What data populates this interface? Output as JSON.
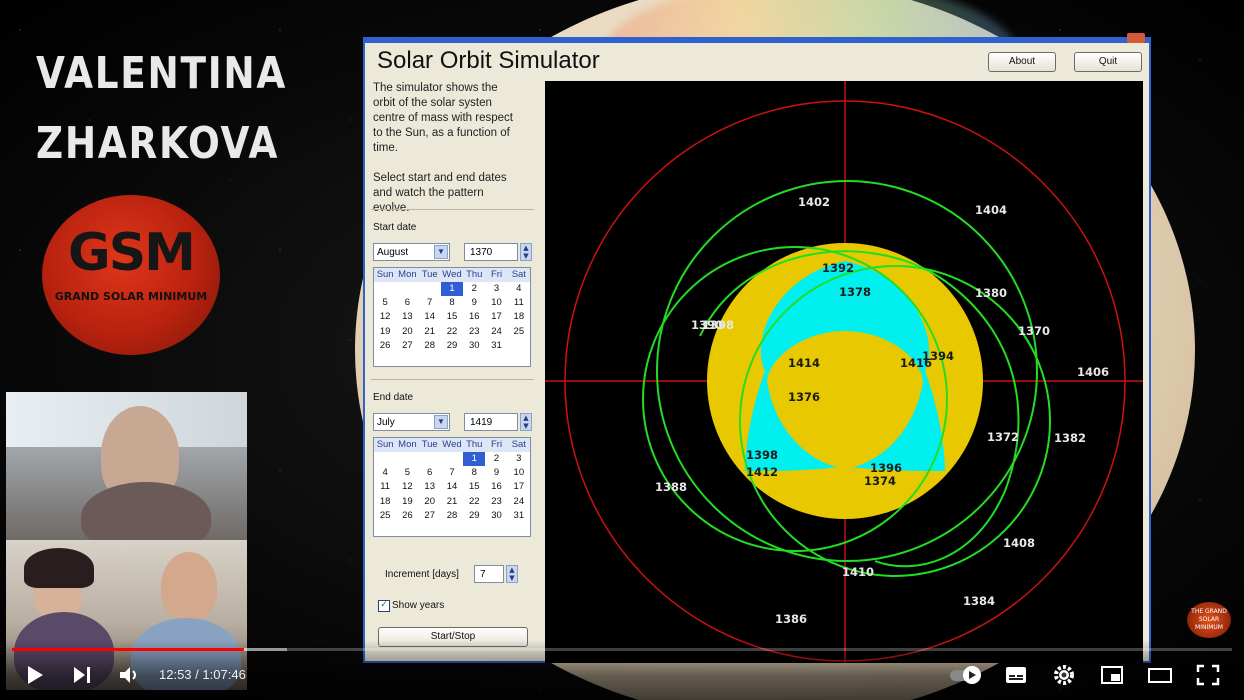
{
  "overlay": {
    "name_line1": "VALENTINA",
    "name_line2": "ZHARKOVA",
    "logo_big": "GSM",
    "logo_small": "GRAND SOLAR MINIMUM",
    "corner_badge": "THE GRAND SOLAR MINIMUM"
  },
  "app": {
    "title": "Solar Orbit Simulator",
    "about_label": "About",
    "quit_label": "Quit",
    "description_1": "The simulator shows the orbit of the solar systen centre of mass with respect to the Sun, as a function of time.",
    "description_2": "Select start and end dates and watch the pattern evolve.",
    "start_date_label": "Start date",
    "start_month": "August",
    "start_year": "1370",
    "end_date_label": "End date",
    "end_month": "July",
    "end_year": "1419",
    "weekdays": [
      "Sun",
      "Mon",
      "Tue",
      "Wed",
      "Thu",
      "Fri",
      "Sat"
    ],
    "start_calendar": [
      [
        "",
        "",
        "",
        "1",
        "2",
        "3",
        "4"
      ],
      [
        "5",
        "6",
        "7",
        "8",
        "9",
        "10",
        "11"
      ],
      [
        "12",
        "13",
        "14",
        "15",
        "16",
        "17",
        "18"
      ],
      [
        "19",
        "20",
        "21",
        "22",
        "23",
        "24",
        "25"
      ],
      [
        "26",
        "27",
        "28",
        "29",
        "30",
        "31",
        ""
      ]
    ],
    "end_calendar": [
      [
        "",
        "",
        "",
        "",
        "1",
        "2",
        "3"
      ],
      [
        "4",
        "5",
        "6",
        "7",
        "8",
        "9",
        "10"
      ],
      [
        "11",
        "12",
        "13",
        "14",
        "15",
        "16",
        "17"
      ],
      [
        "18",
        "19",
        "20",
        "21",
        "22",
        "23",
        "24"
      ],
      [
        "25",
        "26",
        "27",
        "28",
        "29",
        "30",
        "31"
      ]
    ],
    "increment_label": "Increment [days]",
    "increment_value": "7",
    "show_years_label": "Show years",
    "show_years_checked": true,
    "start_stop_label": "Start/Stop"
  },
  "plot": {
    "year_labels": [
      "1402",
      "1404",
      "1392",
      "1378",
      "1380",
      "1370",
      "1390",
      "1398",
      "1414",
      "1416",
      "1394",
      "1406",
      "1376",
      "1372",
      "1382",
      "1398",
      "1412",
      "1396",
      "1374",
      "1388",
      "1408",
      "1410",
      "1384",
      "1386"
    ],
    "colors": {
      "sun": "#e8c800",
      "overlap": "#00f0f0",
      "orbit": "#22dd22",
      "axes": "#cc1111",
      "background": "#000000"
    }
  },
  "player": {
    "time_current": "12:53",
    "time_separator": "/",
    "time_total": "1:07:46",
    "progress_fraction": 0.19,
    "buffered_fraction": 0.225
  }
}
